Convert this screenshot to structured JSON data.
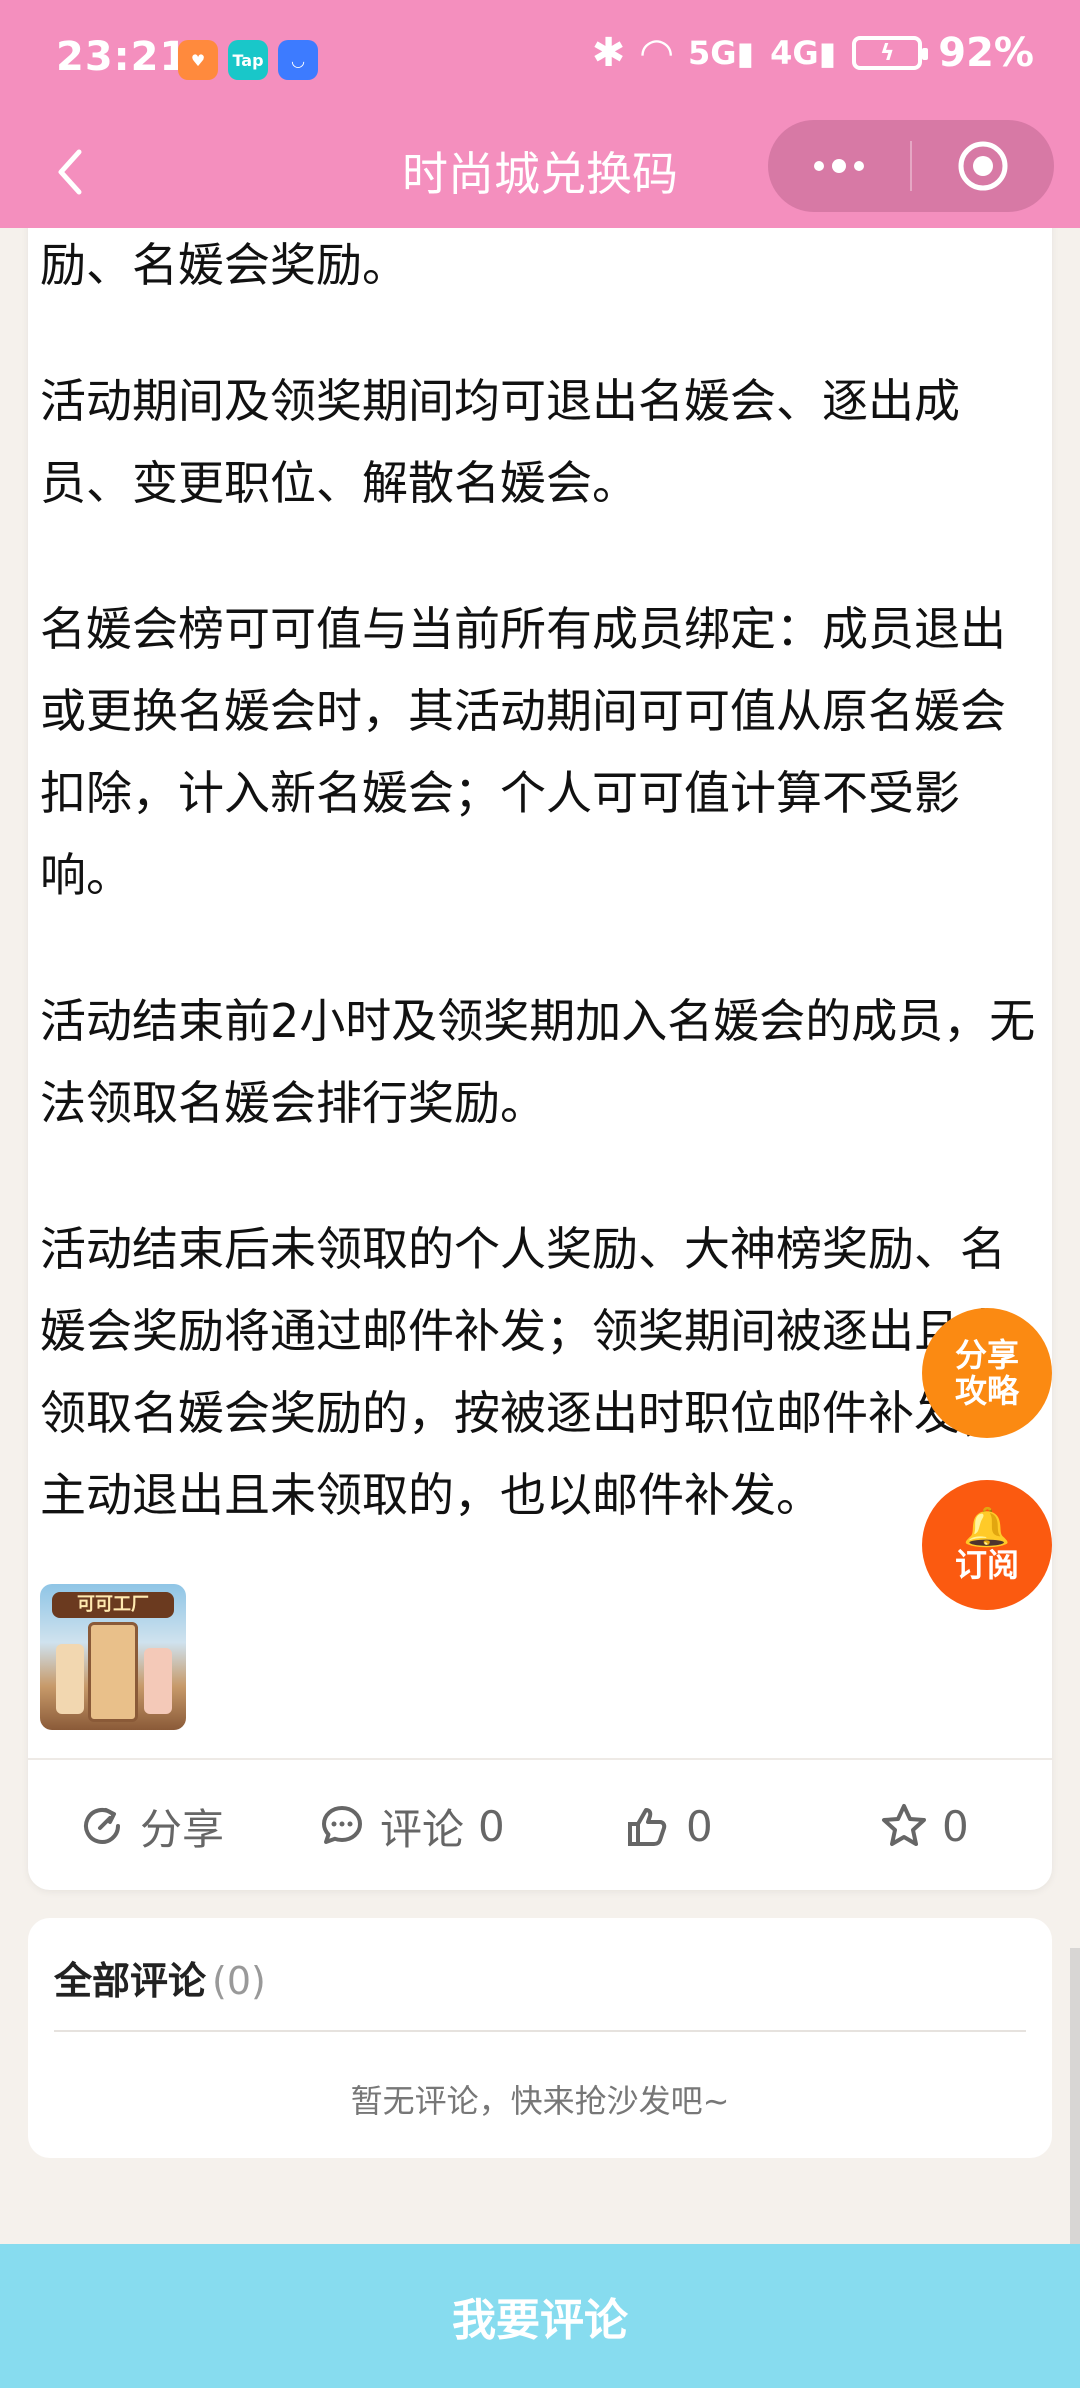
{
  "status_bar": {
    "time": "23:21",
    "app_icons": [
      "app-heart-icon",
      "taptap-icon",
      "market-icon"
    ],
    "tap_label": "Tap",
    "network": "5G",
    "network2": "4G",
    "battery": "92%"
  },
  "nav": {
    "title": "时尚城兑换码",
    "menu_icon": "more-dots-icon",
    "close_icon": "target-icon"
  },
  "article": {
    "paragraphs": [
      "励、名媛会奖励。",
      "活动期间及领奖期间均可退出名媛会、逐出成员、变更职位、解散名媛会。",
      "名媛会榜可可值与当前所有成员绑定：成员退出或更换名媛会时，其活动期间可可值从原名媛会扣除，计入新名媛会；个人可可值计算不受影响。",
      "活动结束前2小时及领奖期加入名媛会的成员，无法领取名媛会排行奖励。",
      "活动结束后未领取的个人奖励、大神榜奖励、名媛会奖励将通过邮件补发；领奖期间被逐出且未领取名媛会奖励的，按被逐出时职位邮件补发；主动退出且未领取的，也以邮件补发。"
    ],
    "thumb_text": "可可工厂"
  },
  "actions": {
    "share": "分享",
    "comment": "评论",
    "comment_count": "0",
    "like_count": "0",
    "fav_count": "0"
  },
  "floating": {
    "share_guide_line1": "分享",
    "share_guide_line2": "攻略",
    "subscribe_icon": "🔔",
    "subscribe": "订阅"
  },
  "comments": {
    "header": "全部评论",
    "count": "(0)",
    "empty_text": "暂无评论，快来抢沙发吧~"
  },
  "bottom": {
    "button": "我要评论"
  },
  "colors": {
    "header_pink": "#f48fbe",
    "bottom_bar": "#87dcef",
    "share_orange": "#fb8a12",
    "subscribe_orange": "#fb5a10"
  }
}
